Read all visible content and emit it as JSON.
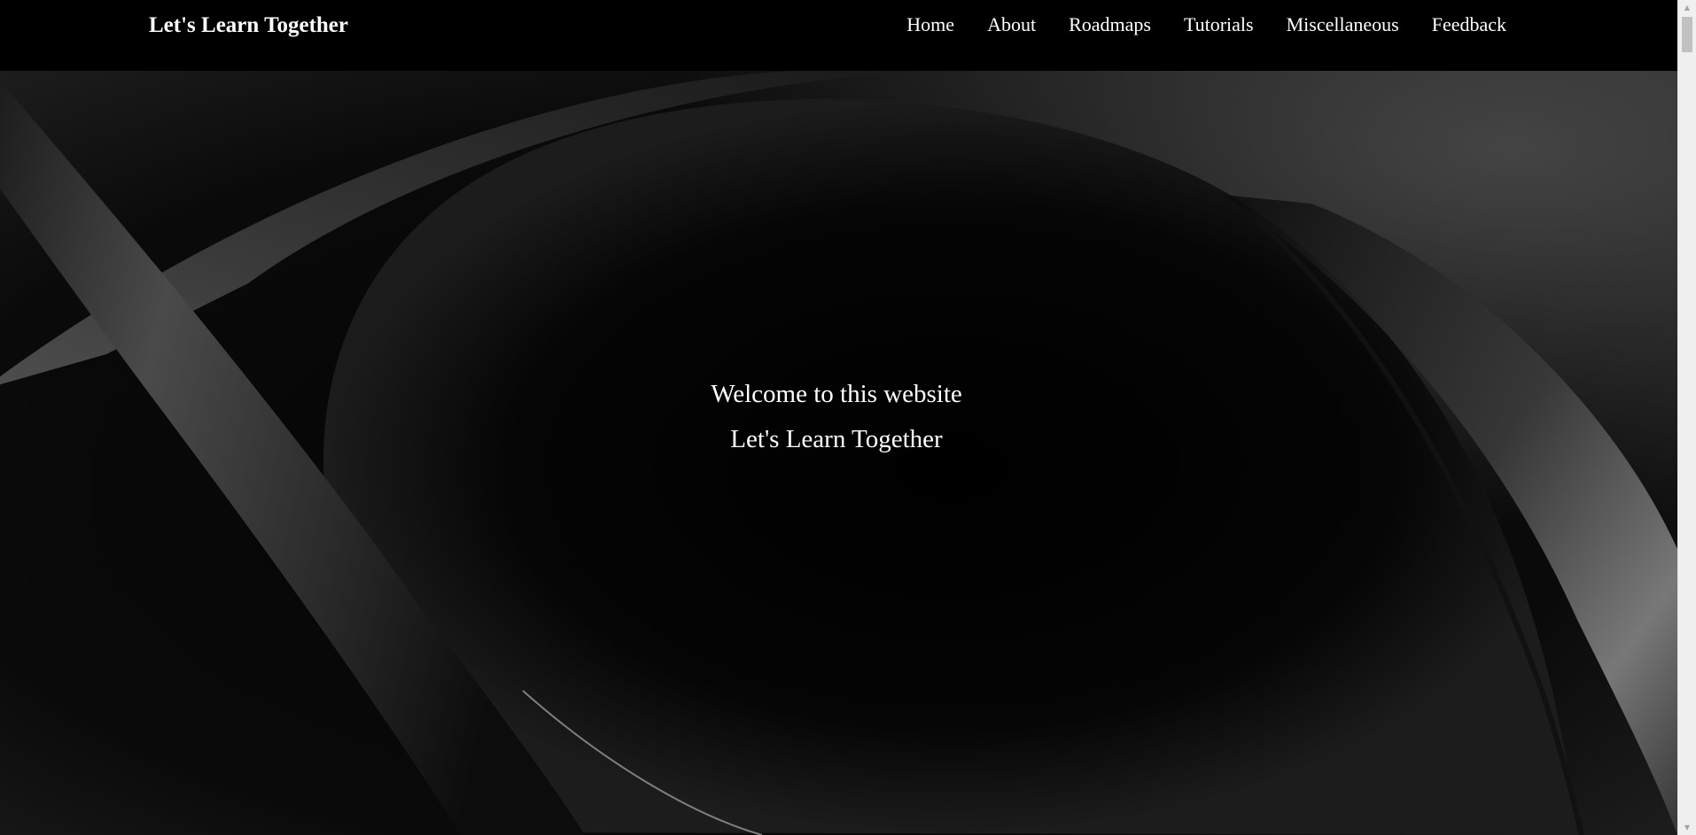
{
  "header": {
    "brand": "Let's Learn Together",
    "nav": [
      {
        "label": "Home"
      },
      {
        "label": "About"
      },
      {
        "label": "Roadmaps"
      },
      {
        "label": "Tutorials"
      },
      {
        "label": "Miscellaneous"
      },
      {
        "label": "Feedback"
      }
    ]
  },
  "hero": {
    "line1": "Welcome to this website",
    "line2": "Let's Learn Together"
  },
  "icons": {
    "scroll_up": "scroll-up-arrow-icon",
    "scroll_down": "scroll-down-arrow-icon"
  },
  "colors": {
    "background": "#000000",
    "text": "#ffffff",
    "scrollbar_track": "#f0f0f0",
    "scrollbar_thumb": "#c1c1c1"
  }
}
